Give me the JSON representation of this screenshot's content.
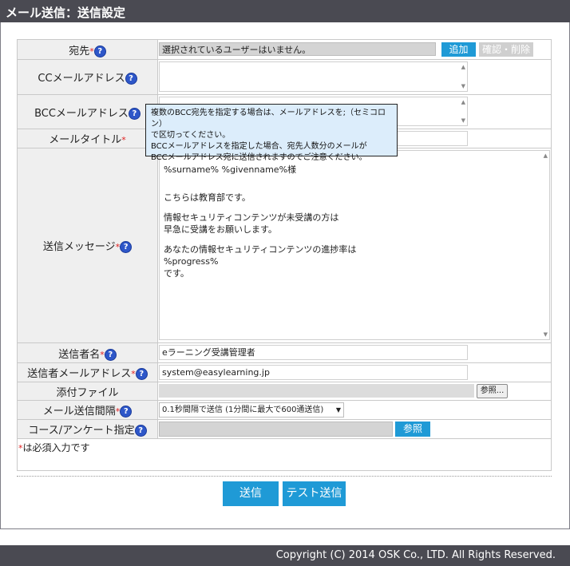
{
  "header": {
    "title": "メール送信：送信設定"
  },
  "form": {
    "to_label": "宛先",
    "to_value": "選択されているユーザーはいません。",
    "add_button": "追加",
    "confirm_delete_button": "確認・削除",
    "cc_label": "CCメールアドレス",
    "bcc_label": "BCCメールアドレス",
    "subject_label": "メールタイトル",
    "message_label": "送信メッセージ",
    "message_lines": {
      "line1": "%surname% %givenname%様",
      "line2": "こちらは教育部です。",
      "line3a": "情報セキュリティコンテンツが未受講の方は",
      "line3b": "早急に受講をお願いします。",
      "line4a": "あなたの情報セキュリティコンテンツの進捗率は",
      "line4b": "%progress%",
      "line4c": "です。"
    },
    "sender_name_label": "送信者名",
    "sender_name_value": "eラーニング受講管理者",
    "sender_email_label": "送信者メールアドレス",
    "sender_email_value": "system@easylearning.jp",
    "attachment_label": "添付ファイル",
    "browse_button": "参照...",
    "interval_label": "メール送信間隔",
    "interval_value": "0.1秒間隔で送信 (1分間に最大で600通送信)",
    "course_label": "コース/アンケート指定",
    "course_button": "参照",
    "required_mark": "*",
    "required_note": "は必須入力です",
    "help_glyph": "?"
  },
  "tooltip": {
    "line1": "複数のBCC宛先を指定する場合は、メールアドレスを;（セミコロン）",
    "line2": "で区切ってください。",
    "line3": "BCCメールアドレスを指定した場合、宛先人数分のメールが",
    "line4": "BCCメールアドレス宛に送信されますのでご注意ください。"
  },
  "actions": {
    "send_button": "送信",
    "test_send_button": "テスト送信"
  },
  "footer": {
    "copyright": "Copyright (C) 2014 OSK Co., LTD. All Rights Reserved."
  },
  "colors": {
    "accent": "#1f9ad6",
    "header_bg": "#4a4a52",
    "required": "#e02020",
    "tooltip_bg": "#dcedfb"
  }
}
